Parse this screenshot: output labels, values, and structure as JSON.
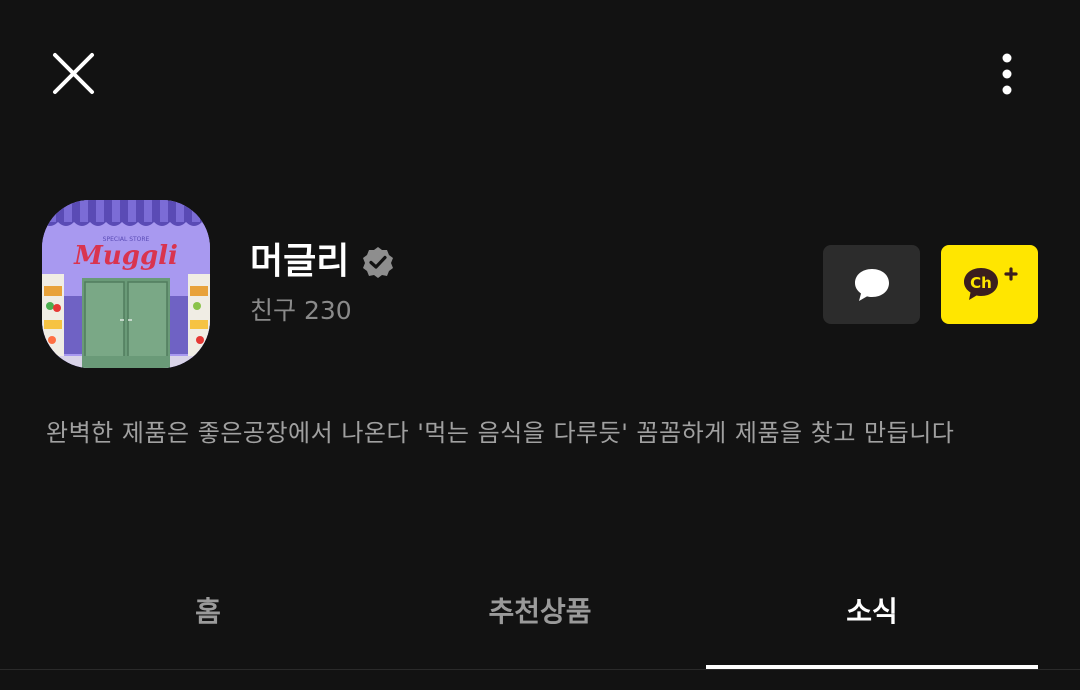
{
  "header": {
    "close_icon": "close-icon",
    "more_icon": "more-vertical-icon"
  },
  "profile": {
    "name": "머글리",
    "verified_icon": "verified-badge-icon",
    "friends_label": "친구 230",
    "avatar": {
      "sign_subtext": "SPECIAL STORE",
      "sign_text": "Muggli"
    }
  },
  "actions": {
    "chat_icon": "chat-bubble-icon",
    "add_channel_label": "Ch"
  },
  "description": "완벽한 제품은 좋은공장에서 나온다 '먹는 음식을 다루듯' 꼼꼼하게 제품을 찾고 만듭니다",
  "tabs": [
    {
      "label": "홈",
      "active": false
    },
    {
      "label": "추천상품",
      "active": false
    },
    {
      "label": "소식",
      "active": true
    }
  ],
  "colors": {
    "background": "#121212",
    "accent_yellow": "#ffe600",
    "chat_button": "#2c2c2c",
    "muted_text": "#8a8a8a"
  }
}
